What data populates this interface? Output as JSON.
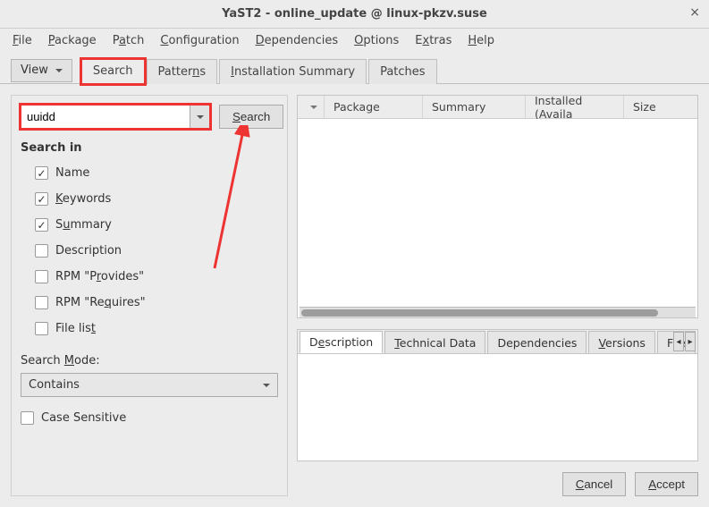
{
  "window": {
    "title": "YaST2 - online_update @ linux-pkzv.suse"
  },
  "menu": {
    "file": "File",
    "package": "Package",
    "patch": "Patch",
    "configuration": "Configuration",
    "dependencies": "Dependencies",
    "options": "Options",
    "extras": "Extras",
    "help": "Help"
  },
  "view_btn": "View",
  "tabs": {
    "search": "Search",
    "patterns": "Patterns",
    "install_summary": "Installation Summary",
    "patches": "Patches"
  },
  "search": {
    "value": "uuidd",
    "button": "Search",
    "section_title": "Search in",
    "name": "Name",
    "keywords": "Keywords",
    "summary": "Summary",
    "description": "Description",
    "rpm_provides": "RPM \"Provides\"",
    "rpm_requires": "RPM \"Requires\"",
    "file_list": "File list",
    "mode_label": "Search Mode:",
    "mode_value": "Contains",
    "case_sensitive": "Case Sensitive"
  },
  "table": {
    "cols": {
      "package": "Package",
      "summary": "Summary",
      "installed": "Installed (Availa",
      "size": "Size"
    }
  },
  "detail_tabs": {
    "description": "Description",
    "technical": "Technical Data",
    "dependencies": "Dependencies",
    "versions": "Versions",
    "file": "File"
  },
  "buttons": {
    "cancel": "Cancel",
    "accept": "Accept"
  }
}
